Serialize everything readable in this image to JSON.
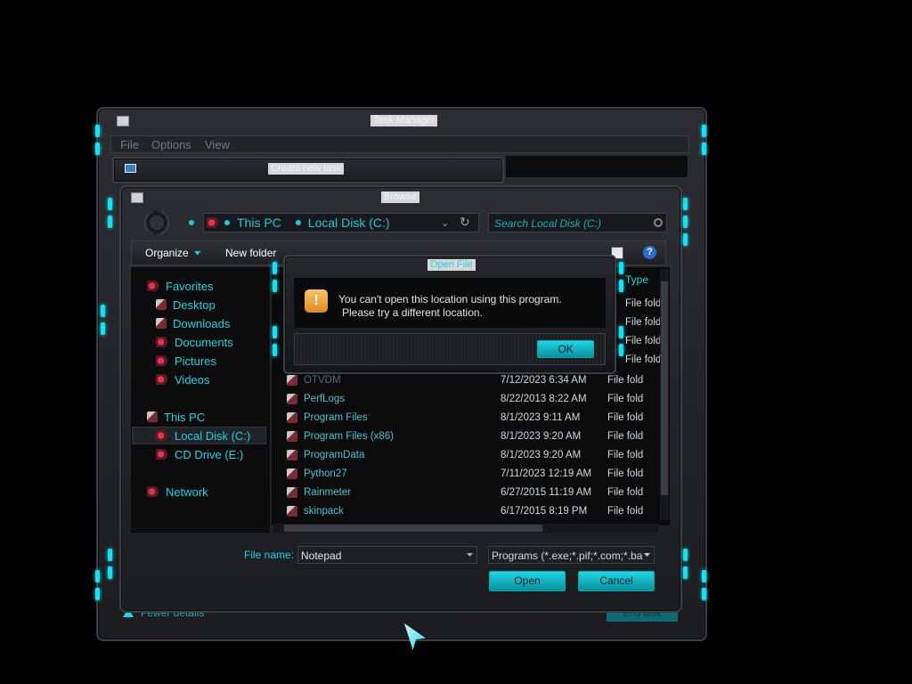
{
  "taskmgr": {
    "title": "Task Manager",
    "menu": [
      "File",
      "Options",
      "View"
    ],
    "fewer_details": "Fewer details",
    "end_task": "End task"
  },
  "create_task": {
    "title": "Create new task"
  },
  "browse": {
    "title": "Browse",
    "breadcrumb": [
      "This PC",
      "Local Disk (C:)"
    ],
    "search_placeholder": "Search Local Disk (C:)",
    "toolbar": {
      "organize": "Organize",
      "new_folder": "New folder"
    },
    "nav": {
      "favorites": "Favorites",
      "desktop": "Desktop",
      "downloads": "Downloads",
      "documents": "Documents",
      "pictures": "Pictures",
      "videos": "Videos",
      "this_pc": "This PC",
      "local_disk": "Local Disk (C:)",
      "cd_drive": "CD Drive (E:)",
      "network": "Network"
    },
    "type_header": "Type",
    "top_types": [
      "File fold",
      "File fold",
      "File fold",
      "File fold"
    ],
    "rows": [
      {
        "name": "OTVDM",
        "date": "7/12/2023 6:34 AM",
        "type": "File fold"
      },
      {
        "name": "PerfLogs",
        "date": "8/22/2013 8:22 AM",
        "type": "File fold"
      },
      {
        "name": "Program Files",
        "date": "8/1/2023 9:11 AM",
        "type": "File fold"
      },
      {
        "name": "Program Files (x86)",
        "date": "8/1/2023 9:20 AM",
        "type": "File fold"
      },
      {
        "name": "ProgramData",
        "date": "8/1/2023 9:20 AM",
        "type": "File fold"
      },
      {
        "name": "Python27",
        "date": "7/11/2023 12:19 AM",
        "type": "File fold"
      },
      {
        "name": "Rainmeter",
        "date": "6/27/2015 11:19 AM",
        "type": "File fold"
      },
      {
        "name": "skinpack",
        "date": "6/17/2015 8:19 PM",
        "type": "File fold"
      }
    ],
    "file_name_label": "File name:",
    "file_name_value": "Notepad",
    "file_type": "Programs (*.exe;*.pif;*.com;*.ba",
    "open_label": "Open",
    "cancel_label": "Cancel"
  },
  "alert": {
    "title": "Open File",
    "message_line1": "You can't open this location using this program.",
    "message_line2": "Please try a different location.",
    "ok_label": "OK"
  },
  "icons": {
    "warning": "warning-icon",
    "back": "back-icon",
    "search": "search-icon",
    "help": "help-icon",
    "refresh": "refresh-icon",
    "cursor": "mouse-cursor-icon"
  },
  "colors": {
    "accent": "#1ed6e6",
    "background": "#000000",
    "frame": "#2b2d32"
  }
}
